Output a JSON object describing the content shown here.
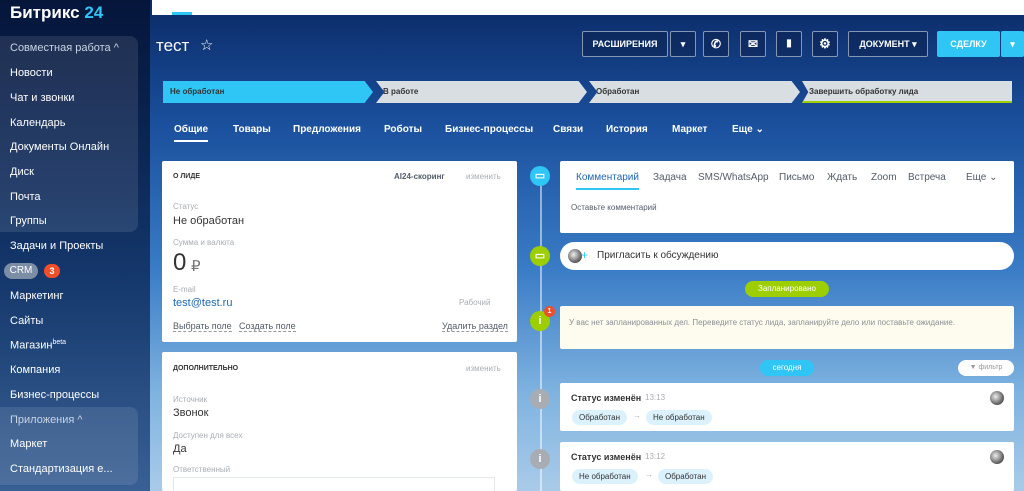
{
  "app": {
    "logo_main": "Битрикс",
    "logo_num": "24"
  },
  "sidebar": {
    "group_work": "Совместная работа ^",
    "items": [
      "Новости",
      "Чат и звонки",
      "Календарь",
      "Документы Онлайн",
      "Диск",
      "Почта",
      "Группы",
      "Задачи и Проекты"
    ],
    "crm": "CRM",
    "crm_count": "3",
    "items2": [
      "Маркетинг",
      "Сайты",
      "Магазин",
      "Компания",
      "Бизнес-процессы"
    ],
    "shop_beta": "beta",
    "group_apps": "Приложения ^",
    "items3": [
      "Маркет",
      "Стандартизация е..."
    ]
  },
  "header": {
    "title": "тест",
    "star": "☆"
  },
  "toolbar": {
    "extensions": "РАСШИРЕНИЯ",
    "dropdown": "▾",
    "document": "ДОКУМЕНТ ▾",
    "deal": "СДЕЛКУ",
    "phone": "✆",
    "mail": "✉",
    "chat": "▮",
    "gear": "⚙"
  },
  "stages": [
    "Не обработан",
    "В работе",
    "Обработан",
    "Завершить обработку лида"
  ],
  "tabs": [
    "Общие",
    "Товары",
    "Предложения",
    "Роботы",
    "Бизнес-процессы",
    "Связи",
    "История",
    "Маркет",
    "Еще ⌄"
  ],
  "lead": {
    "header": "О ЛИДЕ",
    "ai": "AI24-скоринг",
    "edit": "изменить",
    "status_label": "Статус",
    "status_value": "Не обработан",
    "sum_label": "Сумма и валюта",
    "sum_value": "0",
    "currency": "₽",
    "email_label": "E-mail",
    "email_value": "test@test.ru",
    "email_type": "Рабочий",
    "select_field": "Выбрать поле",
    "create_field": "Создать поле",
    "delete_section": "Удалить раздел"
  },
  "extra": {
    "header": "ДОПОЛНИТЕЛЬНО",
    "edit": "изменить",
    "source_label": "Источник",
    "source_value": "Звонок",
    "access_label": "Доступен для всех",
    "access_value": "Да",
    "responsible_label": "Ответственный"
  },
  "activity": {
    "tabs": [
      "Комментарий",
      "Задача",
      "SMS/WhatsApp",
      "Письмо",
      "Ждать",
      "Zoom",
      "Встреча",
      "Еще ⌄"
    ],
    "placeholder": "Оставьте комментарий",
    "invite": "Пригласить к обсуждению",
    "planned": "Запланировано",
    "empty": "У вас нет запланированных дел. Переведите статус лида, запланируйте дело или поставьте ожидание.",
    "empty_badge": "1",
    "today": "сегодня",
    "filter": "фильтр",
    "events": [
      {
        "title": "Статус изменён",
        "time": "13:13",
        "from": "Обработан",
        "to": "Не обработан"
      },
      {
        "title": "Статус изменён",
        "time": "13:12",
        "from": "Не обработан",
        "to": "Обработан"
      }
    ],
    "arrow": "→"
  },
  "colors": {
    "accent": "#2fc6f6",
    "green": "#9dcf00",
    "badge": "#f04e2b"
  }
}
